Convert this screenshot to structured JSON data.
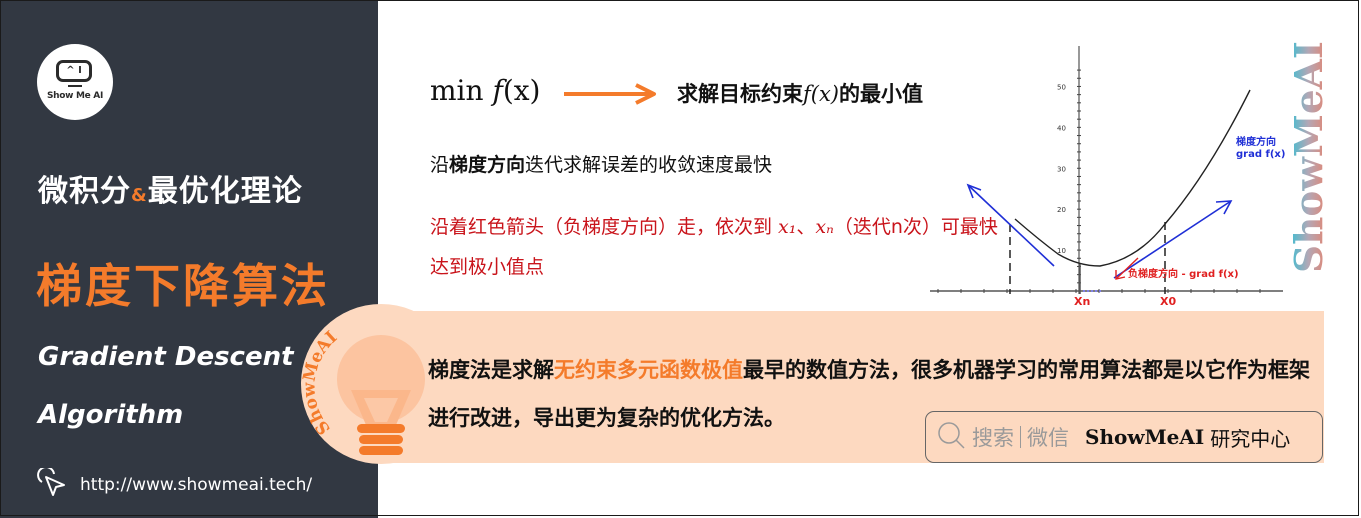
{
  "colors": {
    "sidebar_bg": "#323842",
    "accent_orange": "#f47b2b",
    "callout_bg": "#fdd9c0",
    "red_text": "#c9141b",
    "blue_arrow": "#1f2fd6"
  },
  "sidebar": {
    "logo_screen": "^ I",
    "logo_text": "Show Me AI",
    "subject_part1": "微积分",
    "subject_amp": "&",
    "subject_part2": "最优化理论",
    "title_cn": "梯度下降算法",
    "title_en_line1": "Gradient Descent",
    "title_en_line2": "Algorithm",
    "url": "http://www.showmeai.tech/",
    "url_icon": "cursor-click-icon"
  },
  "main": {
    "formula_min": "min",
    "formula_f": "f",
    "formula_x": "(x)",
    "formula_desc_pre": "求解目标约束",
    "formula_desc_math": "f(x)",
    "formula_desc_post": "的最小值",
    "line2_pre": "沿",
    "line2_bold": "梯度方向",
    "line2_post": "迭代求解误差的收敛速度最快",
    "red_pre": "沿着红色箭头（负梯度方向）走，依次到 ",
    "red_x1": "x₁",
    "red_sep": "、",
    "red_xn": "xₙ",
    "red_post": "（迭代n次）可最快达到极小值点"
  },
  "chart_data": {
    "type": "line",
    "title": "",
    "xlabel": "",
    "ylabel": "",
    "y_ticks": [
      "10",
      "20",
      "30",
      "40",
      "50"
    ],
    "ylim": [
      0,
      55
    ],
    "x_labels": [
      "Xn",
      "X0"
    ],
    "series": [
      {
        "name": "f(x)",
        "description": "convex parabola with minimum near Xn"
      }
    ],
    "annotations": [
      {
        "text_line1": "梯度方向",
        "text_line2": "grad f(x)",
        "color": "#1f2fd6"
      },
      {
        "text": "负梯度方向 - grad f(x)",
        "color": "#e02020"
      }
    ]
  },
  "watermark": "ShowMeAI",
  "callout": {
    "badge_text": "ShowMeAI",
    "text_pre": "梯度法是求解",
    "text_highlight": "无约束多元函数极值",
    "text_post": "最早的数值方法，很多机器学习的常用算法都是以它作为框架进行改进，导出更为复杂的优化方法。"
  },
  "search_badge": {
    "search_icon": "search-icon",
    "label_search": "搜索",
    "label_wechat": "微信",
    "brand": "ShowMeAI",
    "brand_cn": "研究中心"
  }
}
